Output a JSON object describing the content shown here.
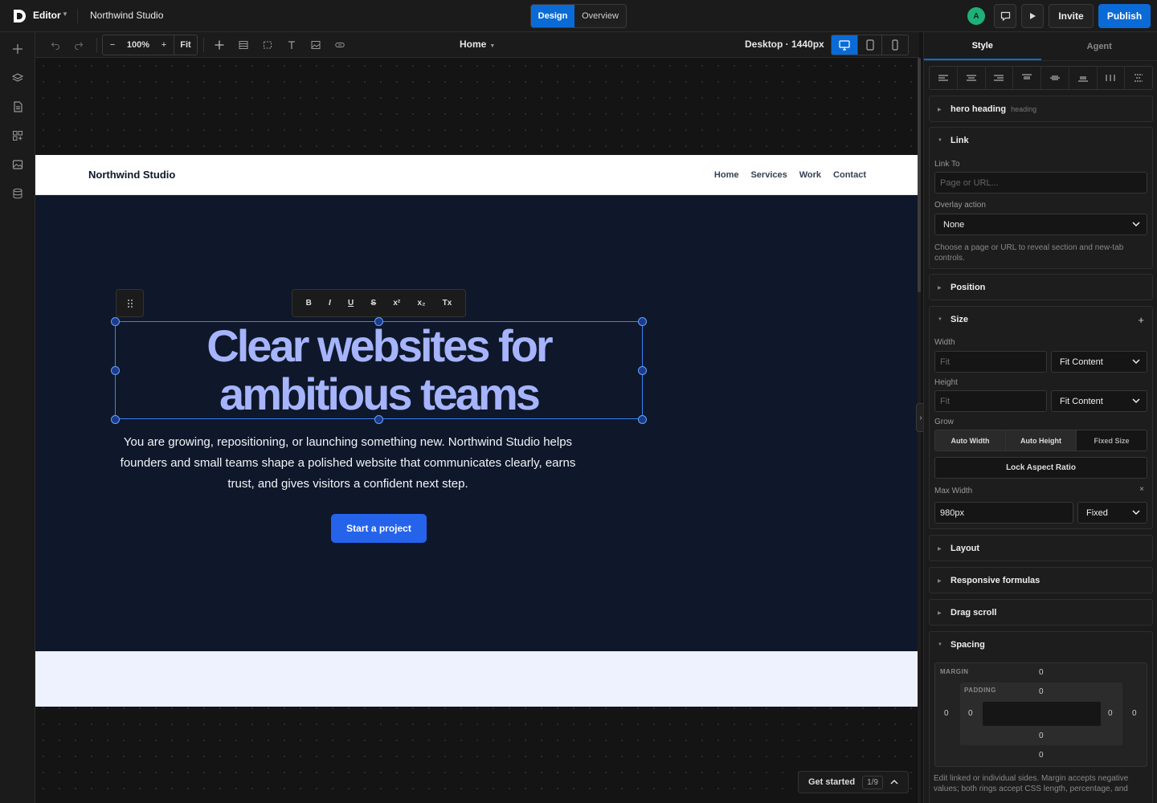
{
  "topbar": {
    "app_label": "Editor",
    "project_name": "Northwind Studio",
    "modes": [
      "Design",
      "Overview"
    ],
    "avatar_initial": "A",
    "invite_label": "Invite",
    "publish_label": "Publish",
    "accent_color": "#0b6bd6"
  },
  "toolbar": {
    "zoom_minus": "−",
    "zoom_value": "100%",
    "zoom_plus": "+",
    "zoom_fit": "Fit",
    "page": "Home",
    "breakpoint": "Desktop · 1440px"
  },
  "canvas": {
    "site_brand": "Northwind Studio",
    "nav_links": [
      "Home",
      "Services",
      "Work",
      "Contact"
    ],
    "hero_heading_line1": "Clear websites for",
    "hero_heading_line2": "ambitious teams",
    "hero_body": "You are growing, repositioning, or launching something new. Northwind Studio helps founders and small teams shape a polished website that communicates clearly, earns trust, and gives visitors a confident next step.",
    "cta_label": "Start a project",
    "format_tools": [
      "B",
      "I",
      "U",
      "S",
      "x²",
      "x₂",
      "Tx"
    ],
    "get_started_label": "Get started",
    "get_started_count": "1/9"
  },
  "panel": {
    "tabs": [
      "Style",
      "Agent"
    ],
    "element_name": "hero heading",
    "element_tag": "heading",
    "link": {
      "title": "Link",
      "link_to_label": "Link To",
      "link_to_placeholder": "Page or URL...",
      "overlay_label": "Overlay action",
      "overlay_value": "None",
      "hint": "Choose a page or URL to reveal section and new-tab controls."
    },
    "position_title": "Position",
    "size": {
      "title": "Size",
      "width_label": "Width",
      "width_placeholder": "Fit",
      "width_mode": "Fit Content",
      "height_label": "Height",
      "height_placeholder": "Fit",
      "height_mode": "Fit Content",
      "grow_label": "Grow",
      "grow_options": [
        "Auto Width",
        "Auto Height",
        "Fixed Size"
      ],
      "lock_label": "Lock Aspect Ratio",
      "max_width_label": "Max Width",
      "max_width_value": "980px",
      "max_width_mode": "Fixed"
    },
    "layout_title": "Layout",
    "responsive_title": "Responsive formulas",
    "drag_scroll_title": "Drag scroll",
    "spacing": {
      "title": "Spacing",
      "margin_label": "MARGIN",
      "padding_label": "PADDING",
      "margin_top": "0",
      "margin_right": "0",
      "margin_bottom": "0",
      "margin_left": "0",
      "padding_top": "0",
      "padding_right": "0",
      "padding_bottom": "0",
      "padding_left": "0",
      "hint": "Edit linked or individual sides. Margin accepts negative values; both rings accept CSS length, percentage, and"
    }
  }
}
